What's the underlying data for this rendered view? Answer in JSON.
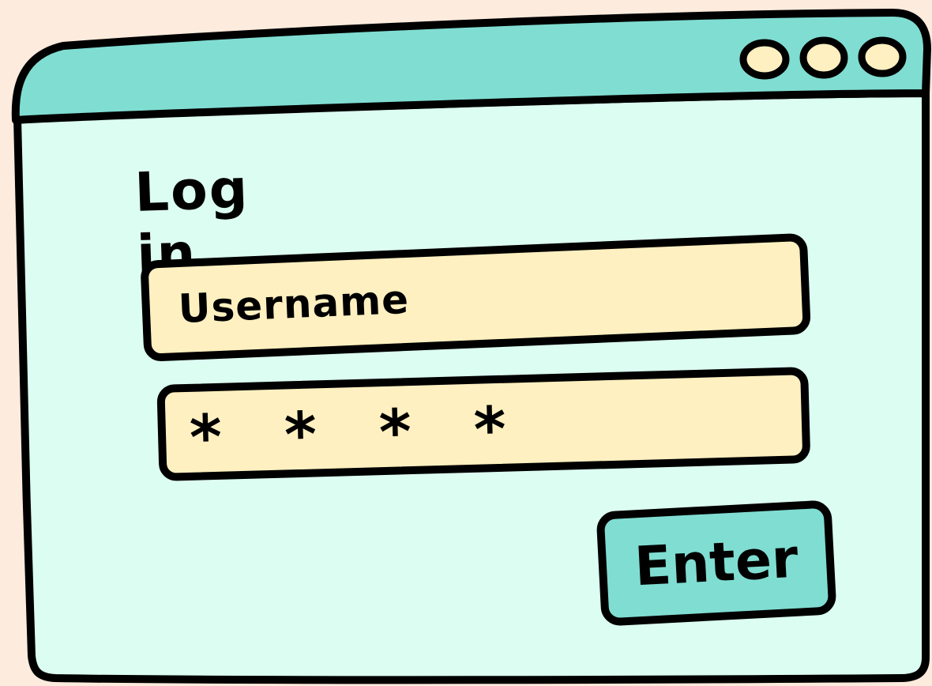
{
  "window": {
    "controls": [
      "circle-icon",
      "circle-icon",
      "circle-icon"
    ]
  },
  "login": {
    "heading": "Log in",
    "username_field": {
      "value": "Username"
    },
    "password_field": {
      "value": "* * * *"
    },
    "enter_label": "Enter"
  },
  "colors": {
    "background": "#FDEBDD",
    "titlebar": "#80DDD2",
    "window_body": "#DCFDF2",
    "field": "#FEF0C0",
    "button": "#80DDD2",
    "control_dot": "#FEF0C0",
    "outline": "#000000"
  }
}
